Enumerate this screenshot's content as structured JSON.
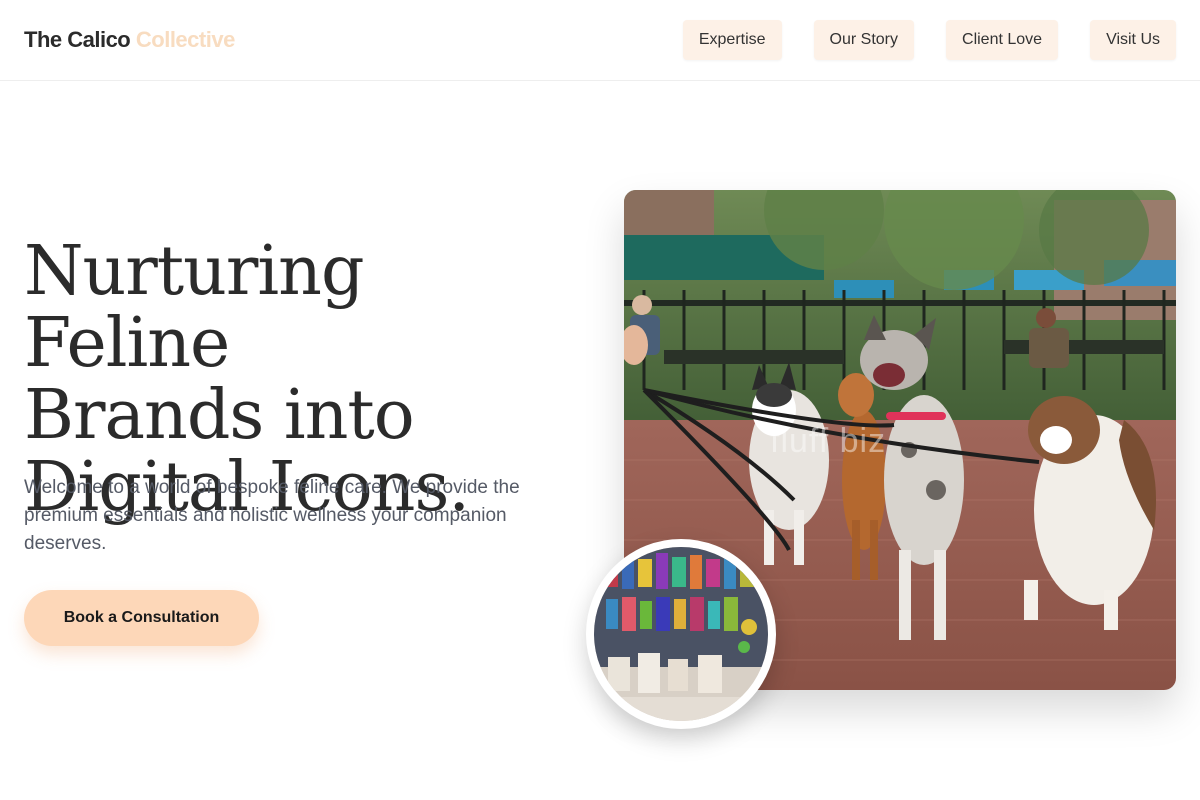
{
  "header": {
    "logo_primary": "The Calico",
    "logo_accent": "Collective",
    "nav": [
      "Expertise",
      "Our Story",
      "Client Love",
      "Visit Us"
    ]
  },
  "hero": {
    "title_line1": "Nurturing Feline",
    "title_line2": "Brands into",
    "title_line3": "Digital Icons.",
    "subtitle": "Welcome to a world of bespoke feline care. We provide the premium essentials and holistic wellness your companion deserves.",
    "cta_label": "Book a Consultation",
    "photo_watermark": "fluff    biz"
  },
  "colors": {
    "accent": "#f8dcc0",
    "cta_bg": "#fdd7b8",
    "nav_bg": "#fdf1e7"
  }
}
